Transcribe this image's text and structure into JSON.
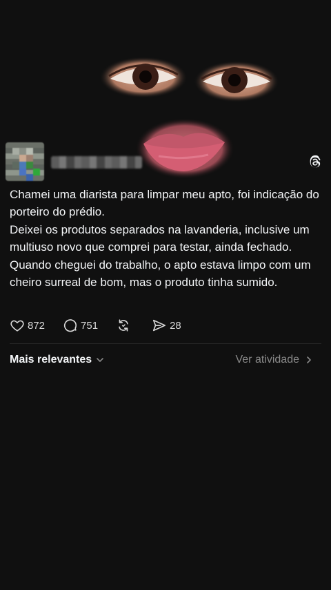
{
  "post": {
    "paragraphs": [
      "Chamei uma diarista para limpar meu apto, foi indicação do porteiro do prédio.",
      "Deixei os produtos separados na lavanderia, inclusive um multiuso novo que comprei para testar, ainda fechado.",
      "Quando cheguei do trabalho, o apto estava limpo com um cheiro surreal de bom, mas o produto tinha sumido."
    ]
  },
  "actions": {
    "likes": "872",
    "comments": "751",
    "shares": "28"
  },
  "comments_bar": {
    "sort_label": "Mais relevantes",
    "activity_label": "Ver atividade"
  },
  "icons": {
    "like": "heart-icon",
    "comment": "comment-bubble-icon",
    "repost": "repost-icon",
    "share": "send-icon",
    "app": "threads-logo-icon"
  },
  "colors": {
    "background": "#101010",
    "text": "#f3f5f7",
    "muted": "#8a8a8a"
  }
}
